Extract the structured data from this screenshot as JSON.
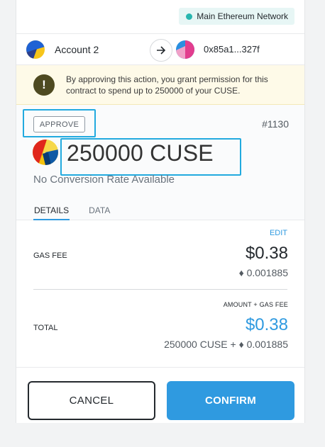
{
  "network": {
    "label": "Main Ethereum Network",
    "dot_color": "#29b6af"
  },
  "accounts": {
    "from_name": "Account 2",
    "to_address": "0x85a1...327f",
    "arrow_icon": "arrow-right-icon"
  },
  "warning": {
    "icon": "exclamation-icon",
    "text": "By approving this action, you grant permission for this contract to spend up to 250000 of your CUSE."
  },
  "summary": {
    "action_label": "APPROVE",
    "nonce": "#1130",
    "amount": "250000 CUSE",
    "conversion": "No Conversion Rate Available"
  },
  "tabs": [
    {
      "label": "DETAILS",
      "active": true
    },
    {
      "label": "DATA",
      "active": false
    }
  ],
  "details": {
    "edit_label": "EDIT",
    "gas_fee_label": "GAS FEE",
    "gas_fee_fiat": "$0.38",
    "gas_fee_eth": "♦ 0.001885",
    "amount_gas_label": "AMOUNT + GAS FEE",
    "total_label": "TOTAL",
    "total_fiat": "$0.38",
    "total_sub": "250000 CUSE + ♦ 0.001885"
  },
  "buttons": {
    "cancel": "CANCEL",
    "confirm": "CONFIRM"
  },
  "colors": {
    "accent": "#2f9ae0",
    "highlight": "#22aadf",
    "warning_bg": "#fefae8"
  }
}
